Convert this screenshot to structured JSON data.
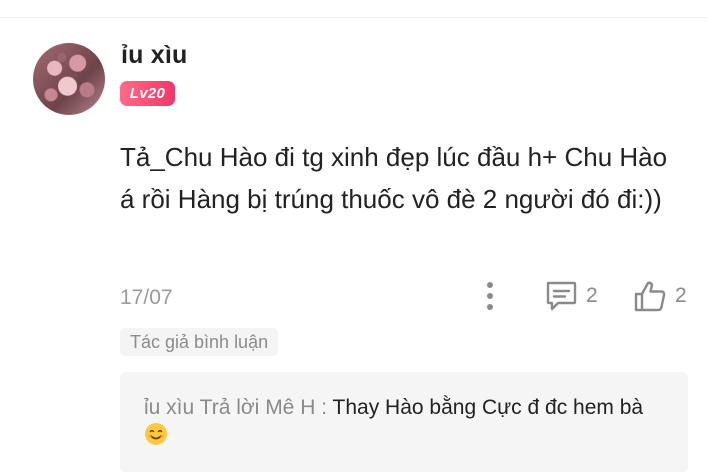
{
  "comment": {
    "username": "ỉu xìu",
    "level_badge": "Lv20",
    "text": "Tả_Chu Hào đi tg xinh đẹp lúc đầu h+ Chu Hào á rồi Hàng bị trúng thuốc vô đè 2 người đó đi:))",
    "date": "17/07",
    "reply_count": "2",
    "like_count": "2",
    "author_tag": "Tác giả bình luận"
  },
  "reply": {
    "author": "ỉu xìu",
    "action": "Trả lời",
    "target": "Mê H",
    "separator": ":",
    "text": "Thay Hào bằng Cực đ đc hem bà"
  },
  "icons": {
    "more": "more-vertical-icon",
    "reply": "comment-bubble-icon",
    "like": "thumbs-up-icon",
    "emoji": "smiling-face-emoji"
  },
  "colors": {
    "badge_start": "#ff6a88",
    "badge_end": "#f0386b",
    "icon_gray": "#8a8a8a",
    "reply_box_bg": "#f5f5f5"
  }
}
